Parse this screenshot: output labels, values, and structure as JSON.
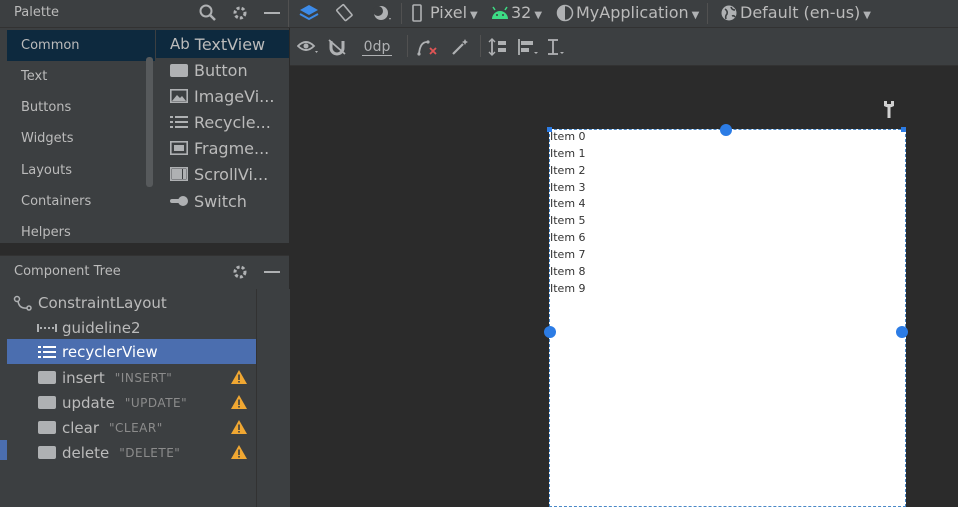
{
  "palette": {
    "title": "Palette",
    "categories": [
      "Common",
      "Text",
      "Buttons",
      "Widgets",
      "Layouts",
      "Containers",
      "Helpers"
    ],
    "selected_category": "Common",
    "widgets": [
      "TextView",
      "Button",
      "ImageVi...",
      "Recycle...",
      "Fragme...",
      "ScrollVi...",
      "Switch"
    ],
    "textview_prefix": "Ab"
  },
  "toolbar": {
    "device": "Pixel",
    "api_level": "32",
    "theme": "MyApplication",
    "locale": "Default (en-us)",
    "margin": "0dp"
  },
  "component_tree": {
    "title": "Component Tree",
    "root": "ConstraintLayout",
    "items": [
      {
        "name": "guideline2",
        "text": ""
      },
      {
        "name": "recyclerView",
        "text": ""
      },
      {
        "name": "insert",
        "text": "\"INSERT\""
      },
      {
        "name": "update",
        "text": "\"UPDATE\""
      },
      {
        "name": "clear",
        "text": "\"CLEAR\""
      },
      {
        "name": "delete",
        "text": "\"DELETE\""
      }
    ]
  },
  "preview": {
    "items": [
      "Item 0",
      "Item 1",
      "Item 2",
      "Item 3",
      "Item 4",
      "Item 5",
      "Item 6",
      "Item 7",
      "Item 8",
      "Item 9"
    ]
  },
  "colors": {
    "accent": "#2c7ce5",
    "selection": "#4b6eaf",
    "warning": "#f0a732",
    "android_green": "#3ddc84"
  }
}
